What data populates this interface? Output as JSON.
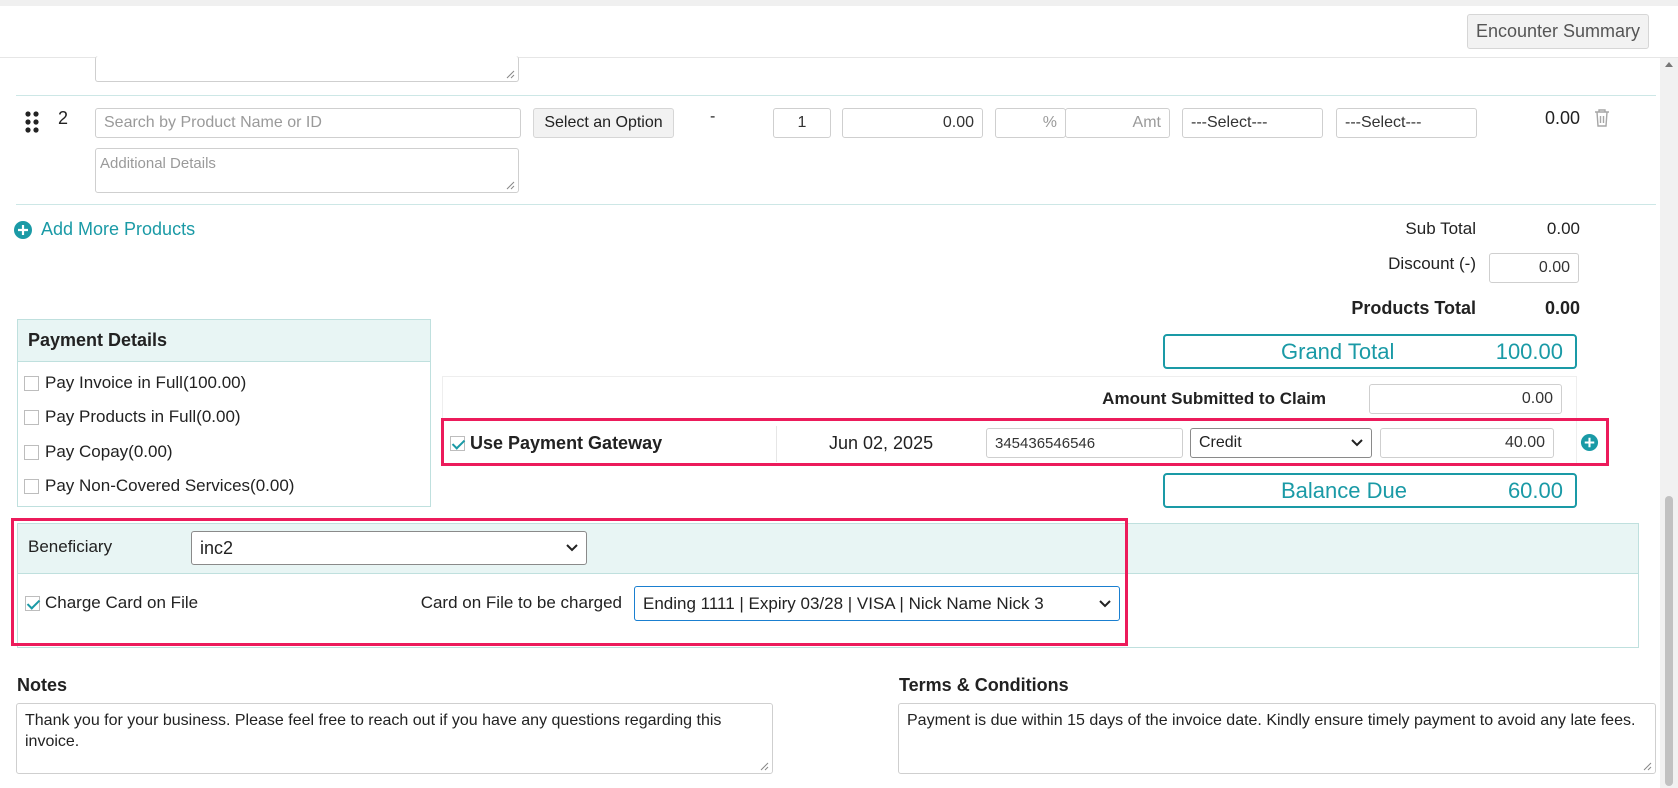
{
  "header": {
    "encounter_summary_label": "Encounter Summary"
  },
  "product_row": {
    "index": "2",
    "search_placeholder": "Search by Product Name or ID",
    "option_button": "Select an Option",
    "dash": "-",
    "qty": "1",
    "price": "0.00",
    "percent_placeholder": "%",
    "amt_placeholder": "Amt",
    "select1": "---Select---",
    "select2": "---Select---",
    "line_total": "0.00",
    "details_placeholder": "Additional Details"
  },
  "add_more_label": "Add More Products",
  "totals": {
    "sub_total_label": "Sub Total",
    "sub_total_value": "0.00",
    "discount_label": "Discount (-)",
    "discount_value": "0.00",
    "products_total_label": "Products Total",
    "products_total_value": "0.00",
    "grand_total_label": "Grand Total",
    "grand_total_value": "100.00",
    "amount_claim_label": "Amount Submitted to Claim",
    "amount_claim_value": "0.00",
    "balance_due_label": "Balance Due",
    "balance_due_value": "60.00"
  },
  "payment_details": {
    "title": "Payment Details",
    "options": [
      {
        "label": "Pay Invoice in Full(100.00)",
        "checked": false
      },
      {
        "label": "Pay Products in Full(0.00)",
        "checked": false
      },
      {
        "label": "Pay Copay(0.00)",
        "checked": false
      },
      {
        "label": "Pay Non-Covered Services(0.00)",
        "checked": false
      }
    ]
  },
  "gateway": {
    "label": "Use Payment Gateway",
    "checked": true,
    "date": "Jun 02, 2025",
    "reference": "345436546546",
    "method": "Credit",
    "amount": "40.00"
  },
  "beneficiary": {
    "label": "Beneficiary",
    "value": "inc2",
    "charge_label": "Charge Card on File",
    "charge_checked": true,
    "card_label": "Card on File to be charged",
    "card_value": "Ending 1111 | Expiry 03/28 | VISA | Nick Name Nick 3"
  },
  "notes": {
    "label": "Notes",
    "text": "Thank you for your business. Please feel free to reach out if you have any questions regarding this invoice."
  },
  "terms": {
    "label": "Terms & Conditions",
    "text": "Payment is due within 15 days of the invoice date. Kindly ensure timely payment to avoid any late fees."
  },
  "colors": {
    "accent": "#1a9aa6",
    "highlight": "#ec1b5b",
    "panel": "#e8f5f4"
  },
  "icons": [
    "drag-handle-icon",
    "trash-icon",
    "plus-circle-icon",
    "chevron-down-icon",
    "resize-grip-icon",
    "check-icon"
  ]
}
